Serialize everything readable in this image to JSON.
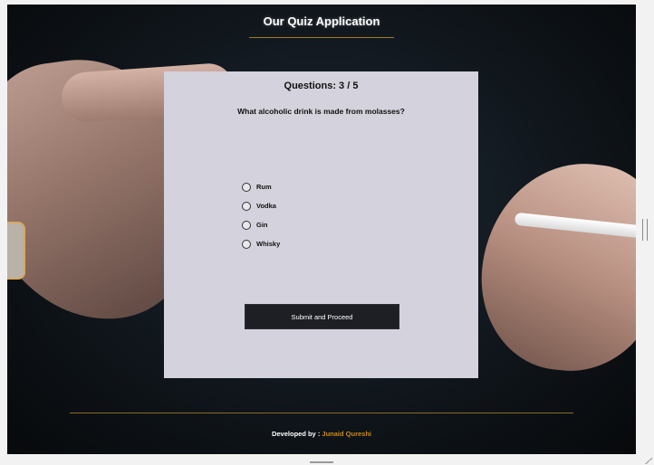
{
  "header": {
    "title": "Our Quiz Application"
  },
  "quiz": {
    "counter": "Questions: 3 / 5",
    "question": "What alcoholic drink is made from molasses?",
    "options": [
      {
        "label": "Rum"
      },
      {
        "label": "Vodka"
      },
      {
        "label": "Gin"
      },
      {
        "label": "Whisky"
      }
    ],
    "submit_label": "Submit and Proceed"
  },
  "footer": {
    "prefix": "Developed by : ",
    "author": "Junaid Qureshi"
  },
  "colors": {
    "accent": "#c98a1e",
    "card_bg": "#d4d2dc",
    "button_bg": "#1e1f25"
  }
}
